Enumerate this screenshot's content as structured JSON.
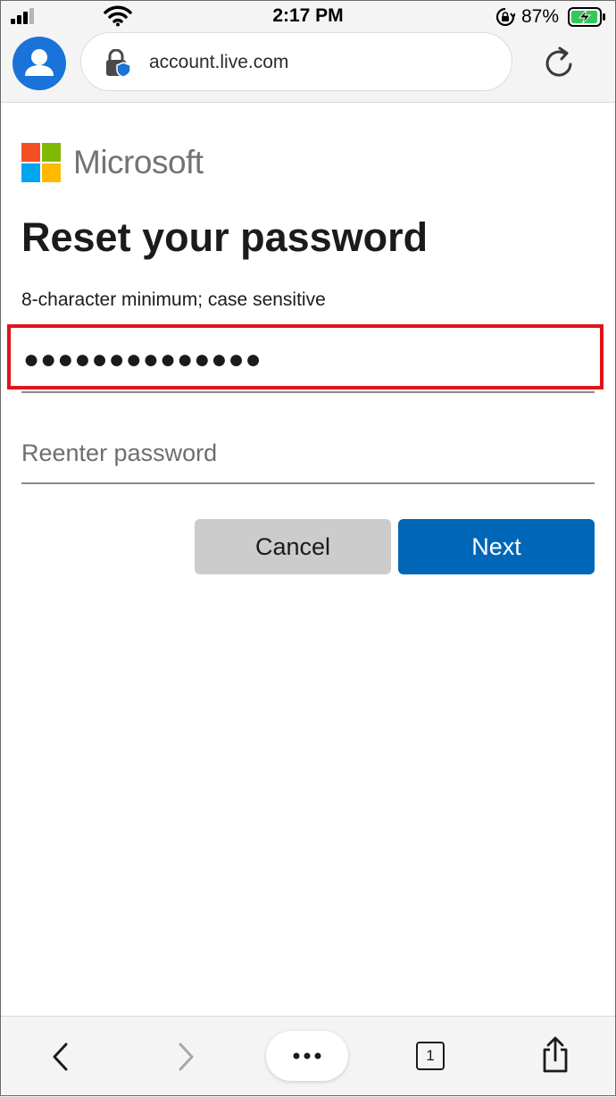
{
  "status_bar": {
    "time": "2:17 PM",
    "battery_percent": "87%",
    "icons": [
      "cellular-signal-icon",
      "wifi-icon",
      "orientation-lock-icon",
      "battery-charging-icon"
    ]
  },
  "browser": {
    "url": "account.live.com",
    "icons": [
      "profile-avatar-icon",
      "site-lock-shield-icon",
      "reload-icon"
    ]
  },
  "page": {
    "brand": "Microsoft",
    "brand_colors": [
      "#f25022",
      "#7fba00",
      "#00a4ef",
      "#ffb900"
    ],
    "title": "Reset your password",
    "hint": "8-character minimum; case sensitive",
    "password_masked": "●●●●●●●●●●●●●●",
    "reenter_placeholder": "Reenter password",
    "cancel_label": "Cancel",
    "next_label": "Next",
    "accent_color": "#0067b8",
    "highlight_color": "#e0141a"
  },
  "bottom_bar": {
    "tab_count": "1",
    "icons": [
      "back-arrow-icon",
      "forward-arrow-icon",
      "more-menu-icon",
      "tabs-icon",
      "share-icon"
    ]
  }
}
